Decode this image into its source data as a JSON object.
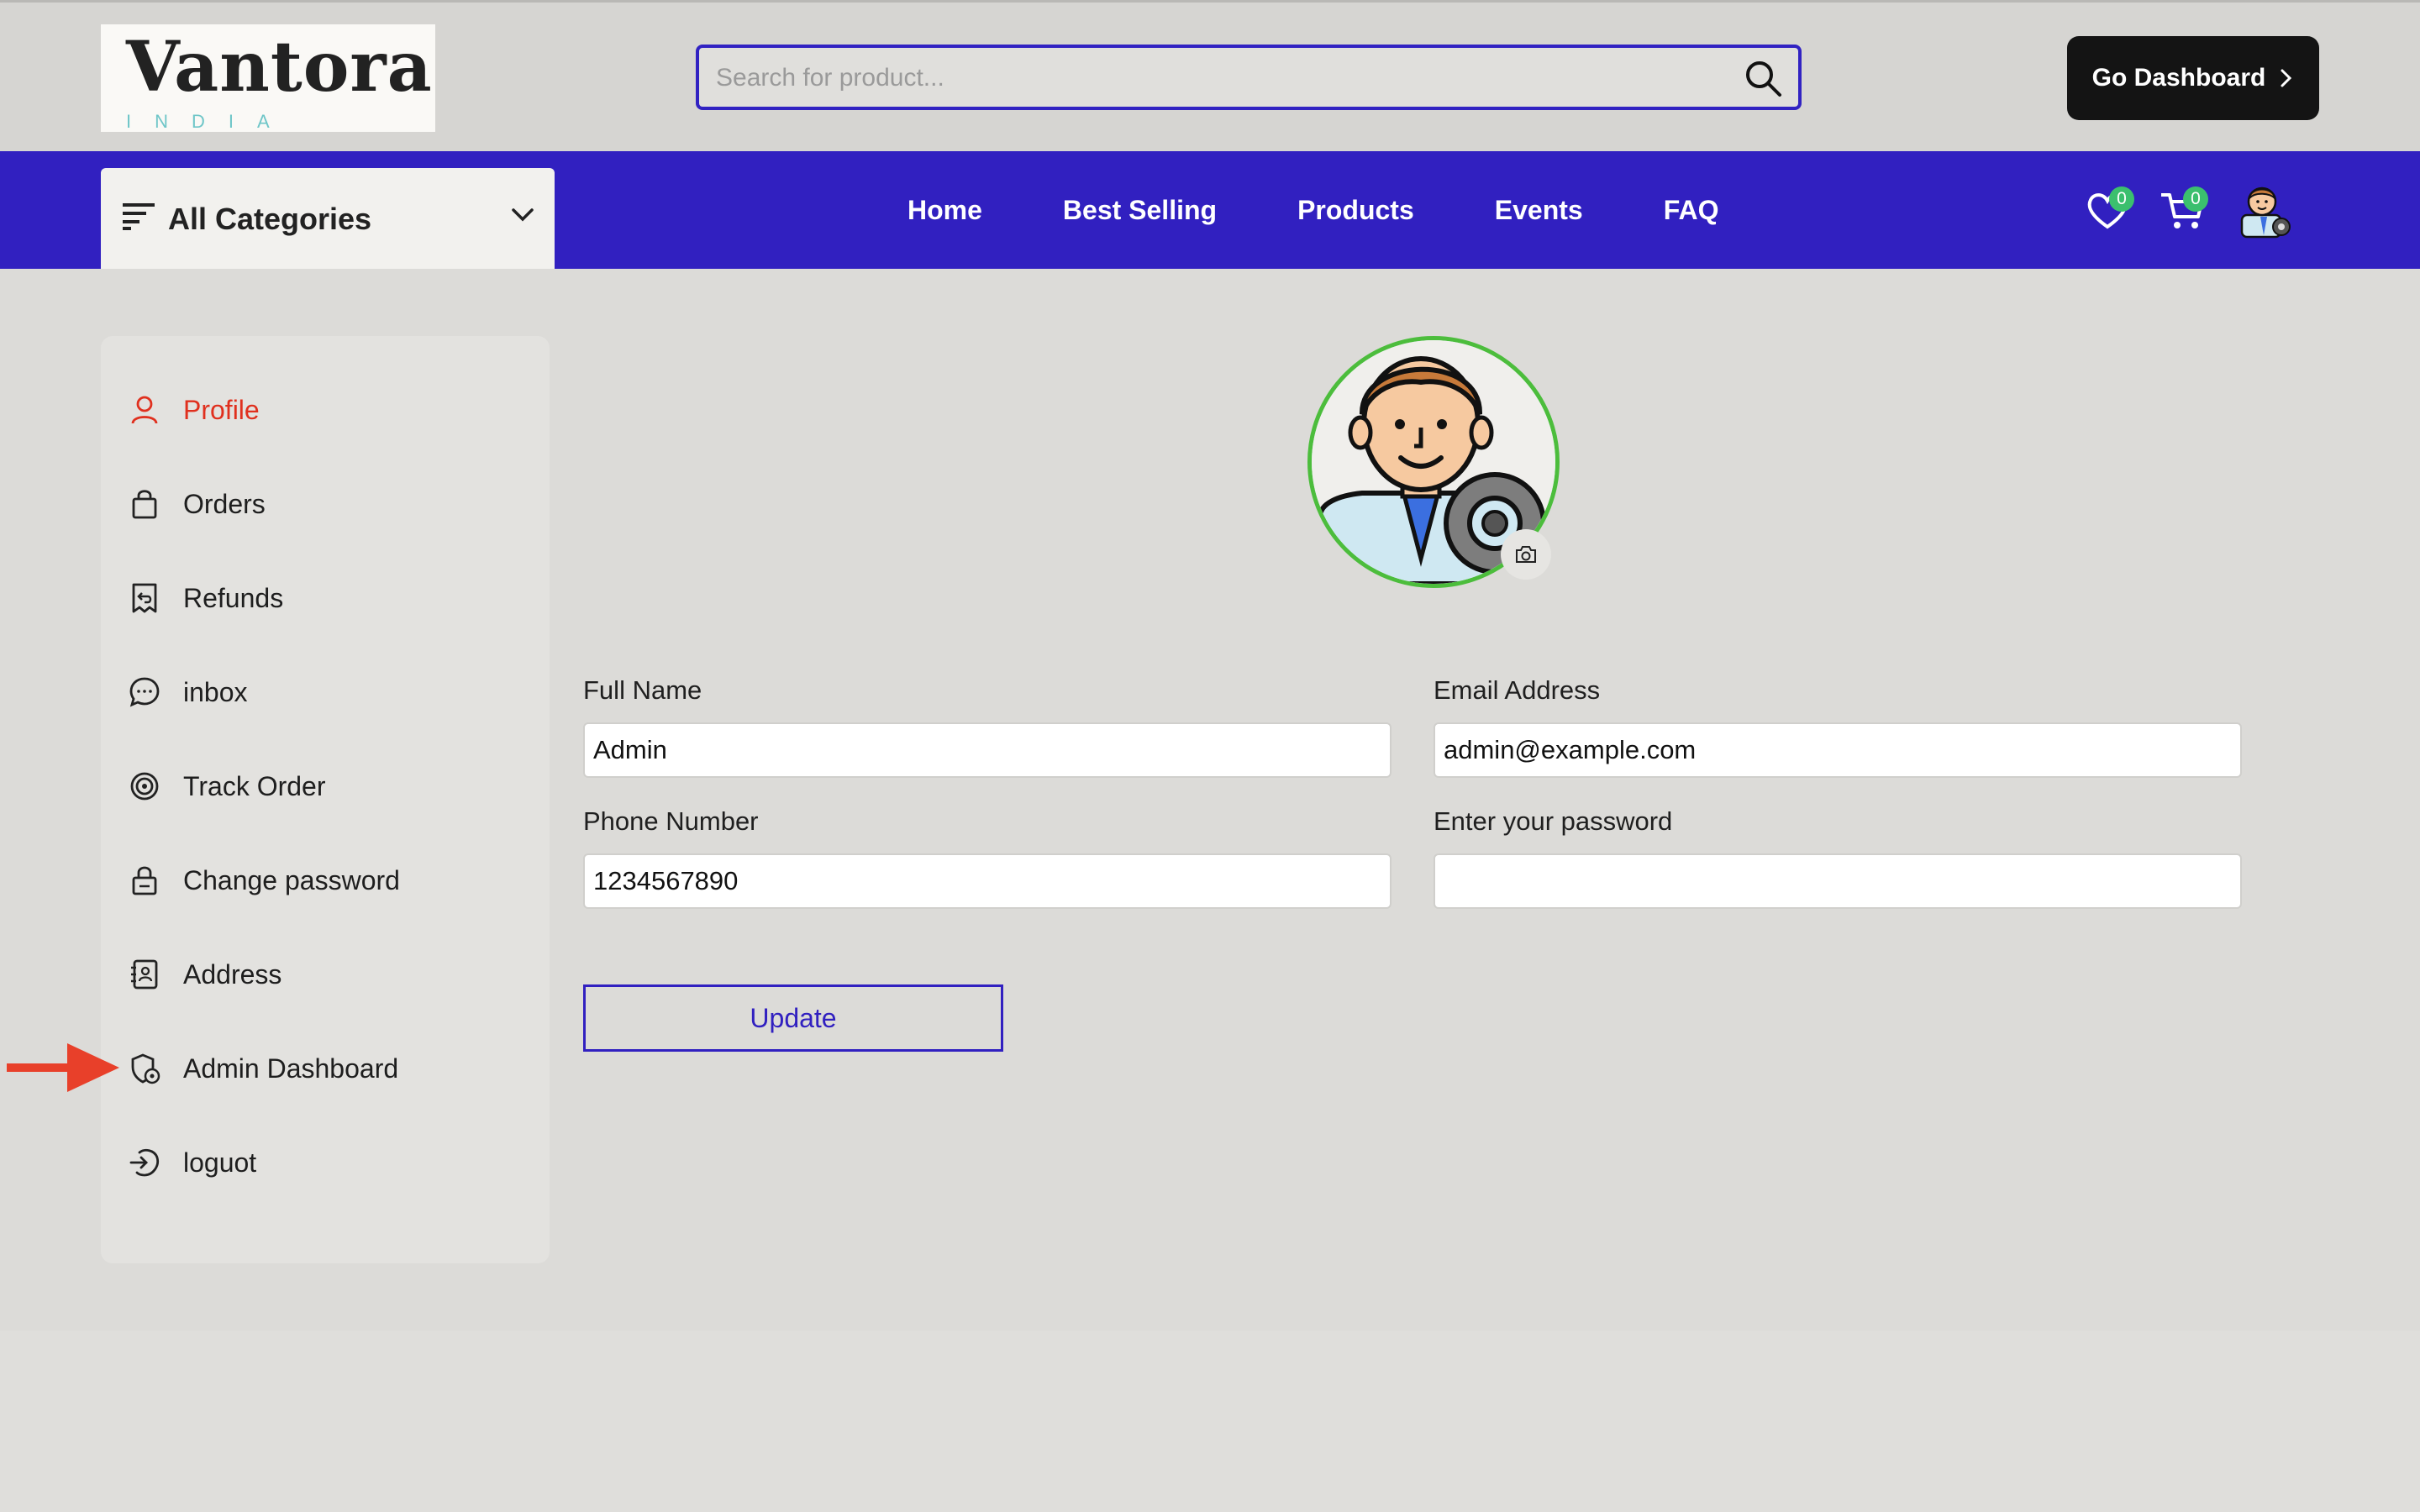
{
  "header": {
    "logo": {
      "brand": "Vantora",
      "sub": "INDIA"
    },
    "search": {
      "placeholder": "Search for product..."
    },
    "go_dashboard": "Go Dashboard"
  },
  "nav": {
    "categories_label": "All Categories",
    "links": [
      "Home",
      "Best Selling",
      "Products",
      "Events",
      "FAQ"
    ],
    "wishlist_count": "0",
    "cart_count": "0"
  },
  "sidebar": {
    "items": [
      {
        "label": "Profile",
        "icon": "user-icon",
        "active": true
      },
      {
        "label": "Orders",
        "icon": "shopping-bag-icon"
      },
      {
        "label": "Refunds",
        "icon": "receipt-refund-icon"
      },
      {
        "label": "inbox",
        "icon": "chat-bubble-icon"
      },
      {
        "label": "Track Order",
        "icon": "target-icon"
      },
      {
        "label": "Change password",
        "icon": "lock-icon"
      },
      {
        "label": "Address",
        "icon": "address-book-icon"
      },
      {
        "label": "Admin Dashboard",
        "icon": "admin-settings-icon"
      },
      {
        "label": "loguot",
        "icon": "logout-icon"
      }
    ]
  },
  "profile": {
    "full_name_label": "Full Name",
    "full_name_value": "Admin",
    "email_label": "Email Address",
    "email_value": "admin@example.com",
    "phone_label": "Phone Number",
    "phone_value": "1234567890",
    "password_label": "Enter your password",
    "password_value": "",
    "update_label": "Update"
  },
  "colors": {
    "brand": "#3120c0",
    "active": "#e0301e",
    "badge": "#3bbf6e",
    "avatar_ring": "#4cbd3c"
  }
}
